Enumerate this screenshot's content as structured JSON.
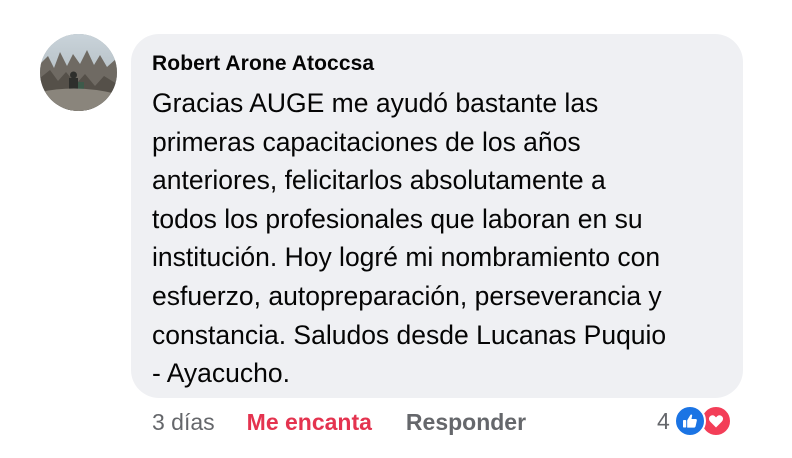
{
  "comment": {
    "author": "Robert Arone Atoccsa",
    "text": "Gracias AUGE me ayudó bastante las\nprimeras capacitaciones de los años\nanteriores, felicitarlos absolutamente a\ntodos los profesionales que laboran en su\ninstitución. Hoy logré mi nombramiento con\nesfuerzo, autopreparación, perseverancia y\nconstancia. Saludos desde Lucanas Puquio\n- Ayacucho."
  },
  "actions": {
    "time": "3 días",
    "reaction_label": "Me encanta",
    "reply_label": "Responder"
  },
  "reactions": {
    "count": "4",
    "types": [
      "like-icon",
      "love-icon"
    ]
  },
  "colors": {
    "bubble": "#eff0f3",
    "love": "#e4334f",
    "like": "#1b74e4",
    "muted": "#65676b"
  }
}
